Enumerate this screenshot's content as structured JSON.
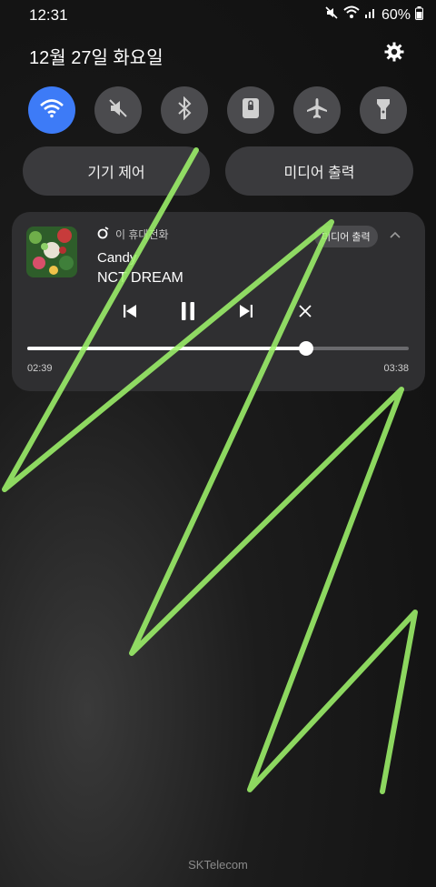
{
  "status": {
    "time": "12:31",
    "battery": "60%",
    "icons": [
      "mute-icon",
      "wifi-icon",
      "signal-icon",
      "battery-icon"
    ]
  },
  "header": {
    "date": "12월 27일 화요일",
    "settings_icon": "gear-icon"
  },
  "quick_settings": {
    "tiles": [
      {
        "name": "wifi",
        "active": true,
        "icon": "wifi-icon"
      },
      {
        "name": "sound",
        "active": false,
        "icon": "mute-icon"
      },
      {
        "name": "bluetooth",
        "active": false,
        "icon": "bluetooth-icon"
      },
      {
        "name": "lock",
        "active": false,
        "icon": "lock-icon"
      },
      {
        "name": "airplane",
        "active": false,
        "icon": "airplane-icon"
      },
      {
        "name": "flashlight",
        "active": false,
        "icon": "flashlight-icon"
      }
    ],
    "device_control": "기기 제어",
    "media_output": "미디어 출력"
  },
  "media": {
    "source": "이 휴대전화",
    "output_button": "미디어 출력",
    "title": "Candy",
    "artist": "NCT DREAM",
    "elapsed": "02:39",
    "duration": "03:38",
    "progress": 0.73
  },
  "footer": {
    "carrier": "SKTelecom"
  },
  "colors": {
    "accent": "#3d7bf7",
    "scribble": "#9df26a"
  }
}
